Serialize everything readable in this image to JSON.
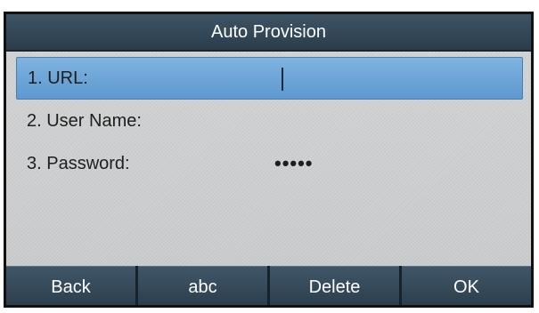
{
  "title": "Auto Provision",
  "fields": [
    {
      "label": "1. URL:",
      "value": ""
    },
    {
      "label": "2. User Name:",
      "value": ""
    },
    {
      "label": "3. Password:",
      "value": "•••••"
    }
  ],
  "softkeys": {
    "back": "Back",
    "input_mode": "abc",
    "delete": "Delete",
    "ok": "OK"
  }
}
